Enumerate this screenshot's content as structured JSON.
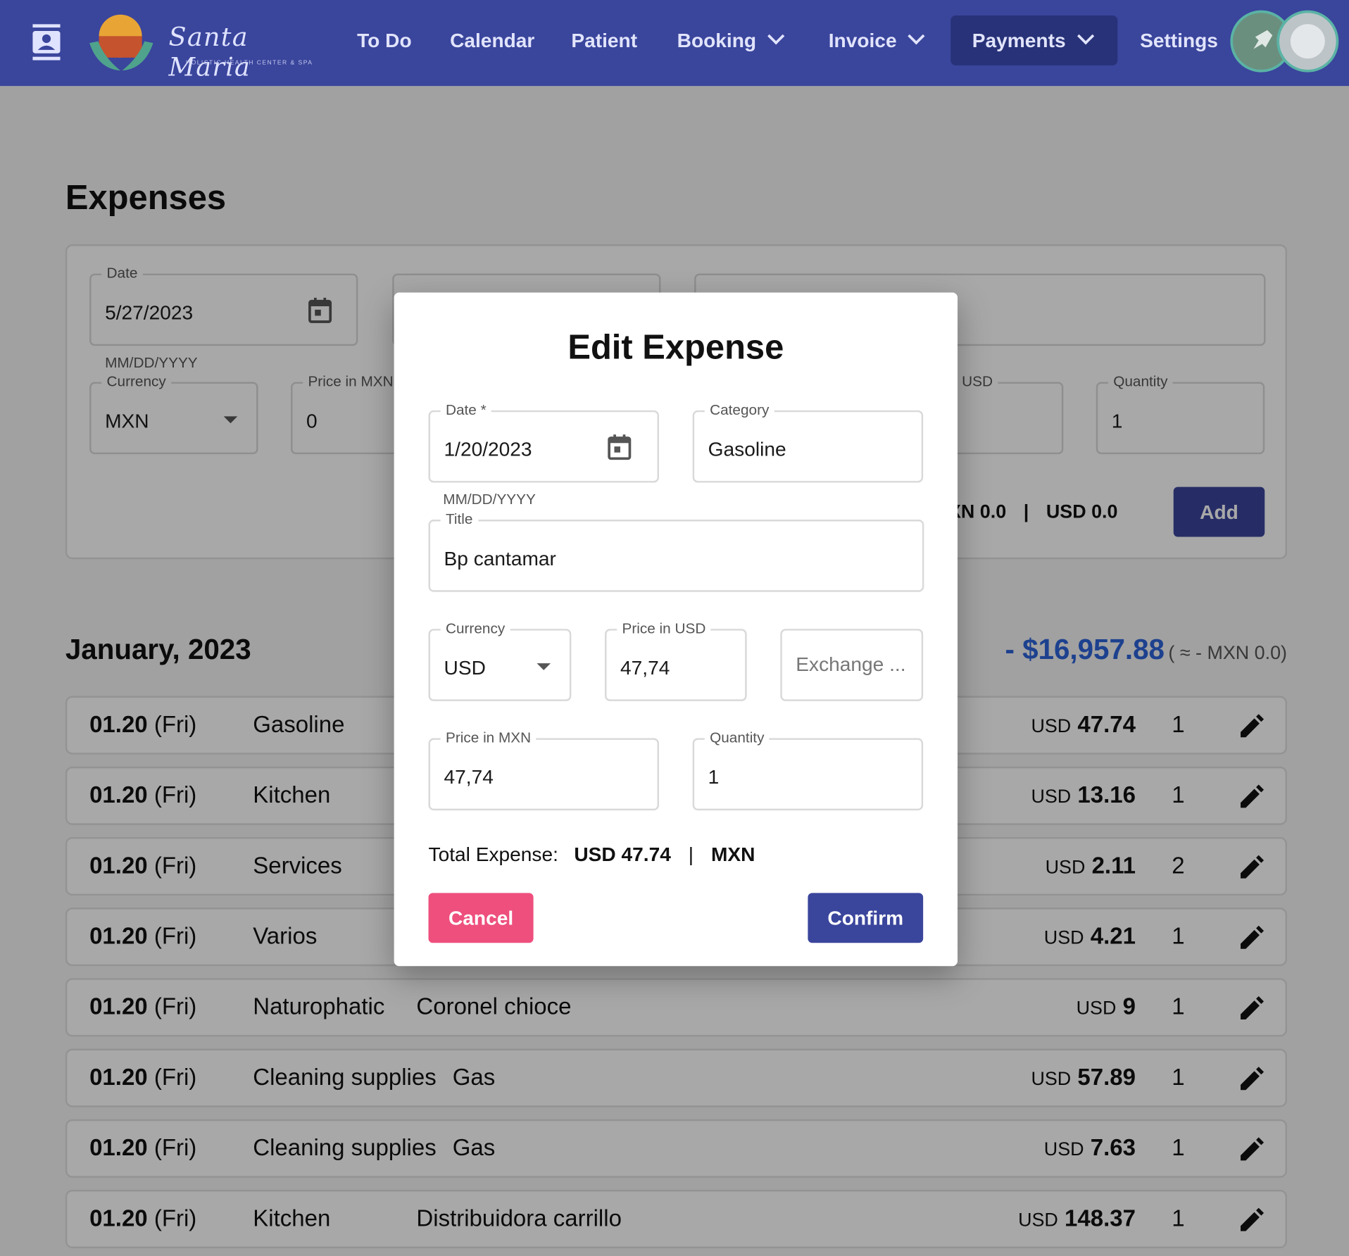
{
  "nav": {
    "logo_text": "Santa Maria",
    "logo_subtext": "HOLISTIC HEALTH CENTER & SPA",
    "items": [
      {
        "label": "To Do"
      },
      {
        "label": "Calendar"
      },
      {
        "label": "Patient"
      },
      {
        "label": "Booking"
      },
      {
        "label": "Invoice"
      },
      {
        "label": "Payments"
      },
      {
        "label": "Settings"
      }
    ],
    "active": "Payments",
    "colors": {
      "bar": "#3a459c",
      "active": "#283278"
    }
  },
  "page": {
    "title": "Expenses"
  },
  "form": {
    "date_label": "Date",
    "date_value": "5/27/2023",
    "date_helper": "MM/DD/YYYY",
    "currency_label": "Currency",
    "currency_value": "MXN",
    "price_mxn_label": "Price in MXN",
    "price_mxn_value": "0",
    "usd_label": "USD",
    "quantity_label": "Quantity",
    "quantity_value": "1",
    "totals_mxn": "MXN 0.0",
    "totals_sep": "|",
    "totals_usd": "USD 0.0",
    "add_label": "Add"
  },
  "month": {
    "title": "January, 2023",
    "total": "- $16,957.88",
    "total_approx": "( ≈ - MXN 0.0)"
  },
  "expenses": [
    {
      "date": "01.20",
      "day": "(Fri)",
      "category": "Gasoline",
      "title": "",
      "currency": "USD",
      "amount": "47.74",
      "qty": "1"
    },
    {
      "date": "01.20",
      "day": "(Fri)",
      "category": "Kitchen",
      "title": "",
      "currency": "USD",
      "amount": "13.16",
      "qty": "1"
    },
    {
      "date": "01.20",
      "day": "(Fri)",
      "category": "Services",
      "title": "",
      "currency": "USD",
      "amount": "2.11",
      "qty": "2"
    },
    {
      "date": "01.20",
      "day": "(Fri)",
      "category": "Varios",
      "title": "",
      "currency": "USD",
      "amount": "4.21",
      "qty": "1"
    },
    {
      "date": "01.20",
      "day": "(Fri)",
      "category": "Naturophatic",
      "title": "Coronel chioce",
      "currency": "USD",
      "amount": "9",
      "qty": "1"
    },
    {
      "date": "01.20",
      "day": "(Fri)",
      "category": "Cleaning supplies",
      "title": "Gas",
      "currency": "USD",
      "amount": "57.89",
      "qty": "1"
    },
    {
      "date": "01.20",
      "day": "(Fri)",
      "category": "Cleaning supplies",
      "title": "Gas",
      "currency": "USD",
      "amount": "7.63",
      "qty": "1"
    },
    {
      "date": "01.20",
      "day": "(Fri)",
      "category": "Kitchen",
      "title": "Distribuidora carrillo",
      "currency": "USD",
      "amount": "148.37",
      "qty": "1"
    }
  ],
  "modal": {
    "title": "Edit Expense",
    "date_label": "Date *",
    "date_value": "1/20/2023",
    "date_helper": "MM/DD/YYYY",
    "category_label": "Category",
    "category_value": "Gasoline",
    "title_label": "Title",
    "title_value": "Bp cantamar",
    "currency_label": "Currency",
    "currency_value": "USD",
    "price_usd_label": "Price in USD",
    "price_usd_value": "47,74",
    "exchange_placeholder": "Exchange ...",
    "price_mxn_label": "Price in MXN",
    "price_mxn_value": "47,74",
    "quantity_label": "Quantity",
    "quantity_value": "1",
    "total_label": "Total Expense:",
    "total_usd": "USD 47.74",
    "total_sep": "|",
    "total_mxn": "MXN",
    "cancel_label": "Cancel",
    "confirm_label": "Confirm",
    "colors": {
      "cancel": "#ee4f7d",
      "confirm": "#3a459c"
    }
  }
}
